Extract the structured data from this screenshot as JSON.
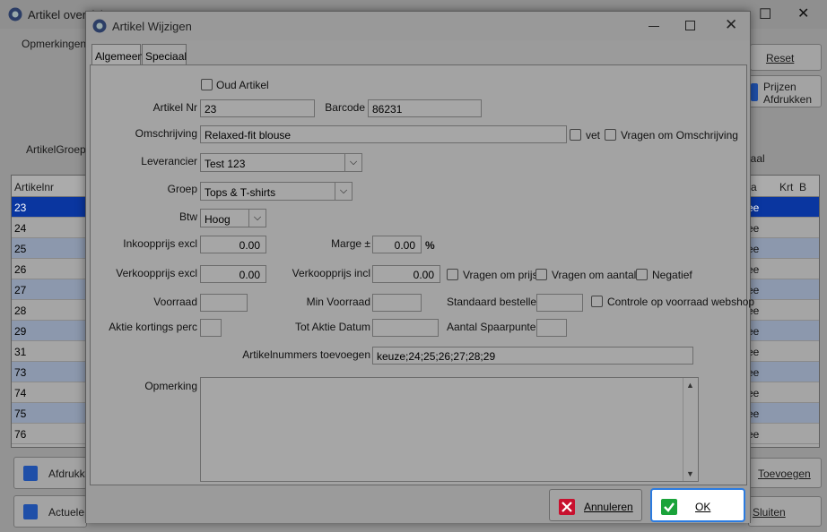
{
  "background_window": {
    "title": "Artikel overzicht",
    "label_opmerkingen": "Opmerkingen",
    "label_artikelgroep": "ArtikelGroep",
    "reset_button": "Reset",
    "print_prices_button_line1": "Prijzen",
    "print_prices_button_line2": "Afdrukken",
    "grid_header_artikelnr": "Artikelnr",
    "grid_header_partial": "a",
    "grid_header_krt": "Krt",
    "grid_header_b": "B",
    "right_label_partial": "iaal",
    "grid_rows": [
      "23",
      "24",
      "25",
      "26",
      "27",
      "28",
      "29",
      "31",
      "73",
      "74",
      "75",
      "76"
    ],
    "grid_right_value": "ee",
    "print_button": "Afdrukken",
    "actual_button": "Actuele",
    "add_button": "Toevoegen",
    "close_button": "Sluiten"
  },
  "dialog": {
    "title": "Artikel Wijzigen",
    "tabs": [
      "Algemeen",
      "Speciaal"
    ],
    "oud_artikel_label": "Oud Artikel",
    "artikel_nr_label": "Artikel Nr",
    "artikel_nr_value": "23",
    "barcode_label": "Barcode",
    "barcode_value": "86231",
    "omschrijving_label": "Omschrijving",
    "omschrijving_value": "Relaxed-fit blouse",
    "vet_label": "vet",
    "vragen_omschrijving_label": "Vragen om Omschrijving",
    "leverancier_label": "Leverancier",
    "leverancier_value": "Test 123",
    "groep_label": "Groep",
    "groep_value": "Tops & T-shirts",
    "btw_label": "Btw",
    "btw_value": "Hoog",
    "inkoopprijs_label": "Inkoopprijs excl",
    "inkoopprijs_value": "0.00",
    "marge_label": "Marge ±",
    "marge_value": "0.00",
    "percent_sign": "%",
    "verkoopprijs_excl_label": "Verkoopprijs excl",
    "verkoopprijs_excl_value": "0.00",
    "verkoopprijs_incl_label": "Verkoopprijs incl",
    "verkoopprijs_incl_value": "0.00",
    "vragen_prijs_label": "Vragen om prijs",
    "vragen_aantal_label": "Vragen om aantal",
    "negatief_label": "Negatief",
    "voorraad_label": "Voorraad",
    "min_voorraad_label": "Min Voorraad",
    "standaard_bestellen_label": "Standaard bestellen",
    "controle_voorraad_label": "Controle op voorraad webshop",
    "aktie_kortings_label": "Aktie kortings perc",
    "tot_aktie_datum_label": "Tot Aktie Datum",
    "aantal_spaarpunten_label": "Aantal Spaarpunten",
    "artikelnummers_toevoegen_label": "Artikelnummers toevoegen",
    "artikelnummers_toevoegen_value": "keuze;24;25;26;27;28;29",
    "opmerking_label": "Opmerking",
    "annuleren_button": "Annuleren",
    "ok_button": "OK"
  },
  "colors": {
    "selected_row": "#0a36a0",
    "ok_border": "#2b7be0",
    "cancel_icon": "#c8102e",
    "ok_icon": "#1aa33a"
  }
}
